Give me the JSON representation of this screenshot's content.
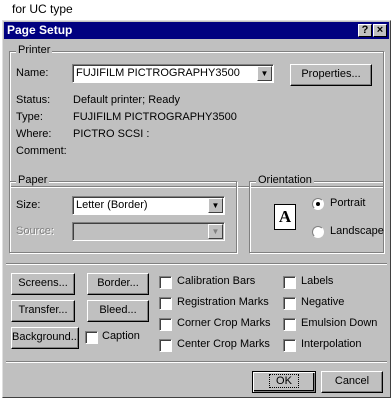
{
  "caption": "for UC type",
  "window": {
    "title": "Page Setup",
    "help_button": "?",
    "close_button": "×"
  },
  "printer": {
    "group_label": "Printer",
    "name_label": "Name:",
    "name_value": "FUJIFILM PICTROGRAPHY3500",
    "properties_button": "Properties...",
    "status_label": "Status:",
    "status_value": "Default printer; Ready",
    "type_label": "Type:",
    "type_value": "FUJIFILM PICTROGRAPHY3500",
    "where_label": "Where:",
    "where_value": "PICTRO SCSI :",
    "comment_label": "Comment:",
    "comment_value": ""
  },
  "paper": {
    "group_label": "Paper",
    "size_label": "Size:",
    "size_value": "Letter (Border)",
    "source_label": "Source:",
    "source_value": ""
  },
  "orientation": {
    "group_label": "Orientation",
    "icon_letter": "A",
    "options": [
      {
        "label": "Portrait",
        "selected": true
      },
      {
        "label": "Landscape",
        "selected": false
      }
    ]
  },
  "buttons": {
    "screens": "Screens...",
    "border": "Border...",
    "transfer": "Transfer...",
    "bleed": "Bleed...",
    "background": "Background..."
  },
  "checkboxes": {
    "caption": "Caption",
    "calibration_bars": "Calibration Bars",
    "registration_marks": "Registration Marks",
    "corner_crop_marks": "Corner Crop Marks",
    "center_crop_marks": "Center Crop Marks",
    "labels": "Labels",
    "negative": "Negative",
    "emulsion_down": "Emulsion Down",
    "interpolation": "Interpolation"
  },
  "footer": {
    "ok": "OK",
    "cancel": "Cancel"
  }
}
